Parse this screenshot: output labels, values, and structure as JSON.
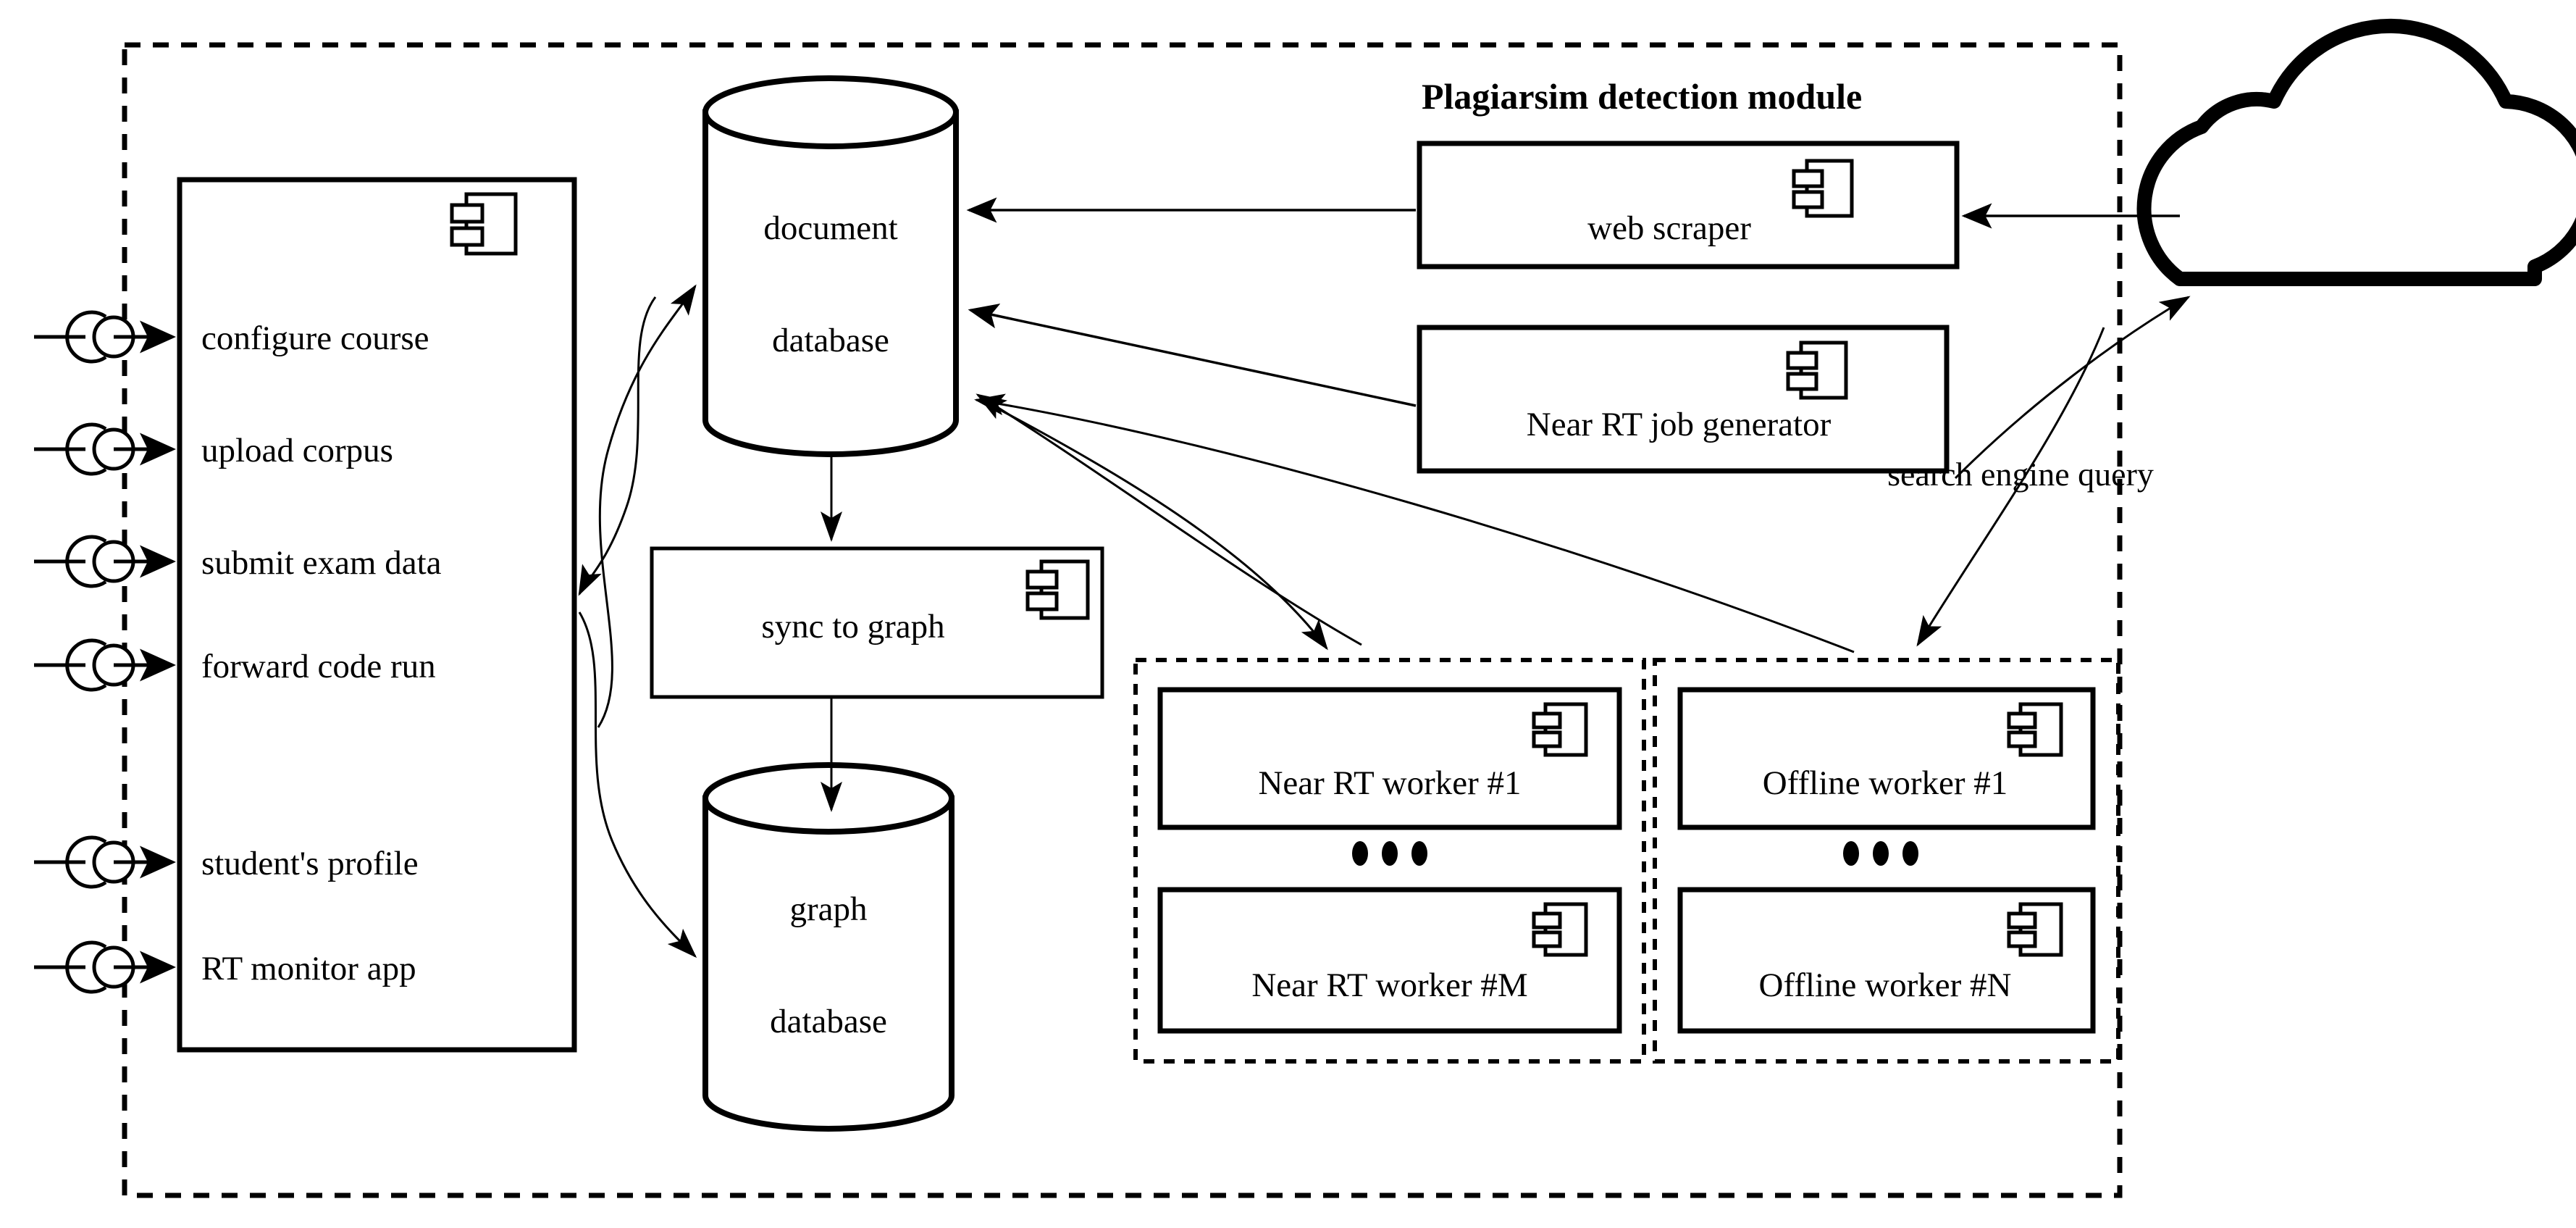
{
  "diagram": {
    "title": "Plagiarsim detection module",
    "system_boundary_name": "system-boundary",
    "edge_label_search_query": "search engine query"
  },
  "main_component": {
    "name": "main-system-component",
    "icon": "component-icon",
    "interfaces": [
      {
        "label": "configure course",
        "icon": "ball-socket-interface-icon"
      },
      {
        "label": "upload corpus",
        "icon": "ball-socket-interface-icon"
      },
      {
        "label": "submit exam data",
        "icon": "ball-socket-interface-icon"
      },
      {
        "label": "forward code run",
        "icon": "ball-socket-interface-icon"
      },
      {
        "label": "student's profile",
        "icon": "ball-socket-interface-icon"
      },
      {
        "label": "RT monitor app",
        "icon": "ball-socket-interface-icon"
      }
    ]
  },
  "datastores": [
    {
      "id": "document-database",
      "line1": "document",
      "line2": "database",
      "icon": "cylinder-icon"
    },
    {
      "id": "graph-database",
      "line1": "graph",
      "line2": "database",
      "icon": "cylinder-icon"
    }
  ],
  "components": [
    {
      "id": "sync-to-graph",
      "label": "sync to graph",
      "icon": "component-icon"
    },
    {
      "id": "web-scraper",
      "label": "web scraper",
      "icon": "component-icon"
    },
    {
      "id": "near-rt-job-generator",
      "label": "Near RT job generator",
      "icon": "component-icon"
    }
  ],
  "worker_groups": [
    {
      "id": "near-rt-worker-group",
      "ellipsis": "•••",
      "workers": [
        {
          "label": "Near RT worker #1",
          "icon": "component-icon"
        },
        {
          "label": "Near RT worker #M",
          "icon": "component-icon"
        }
      ]
    },
    {
      "id": "offline-worker-group",
      "ellipsis": "•••",
      "workers": [
        {
          "label": "Offline worker #1",
          "icon": "component-icon"
        },
        {
          "label": "Offline worker #N",
          "icon": "component-icon"
        }
      ]
    }
  ],
  "external": {
    "cloud": {
      "id": "internet-cloud",
      "icon": "cloud-icon",
      "label": ""
    }
  },
  "colors": {
    "stroke": "#000000",
    "fill": "#ffffff"
  }
}
